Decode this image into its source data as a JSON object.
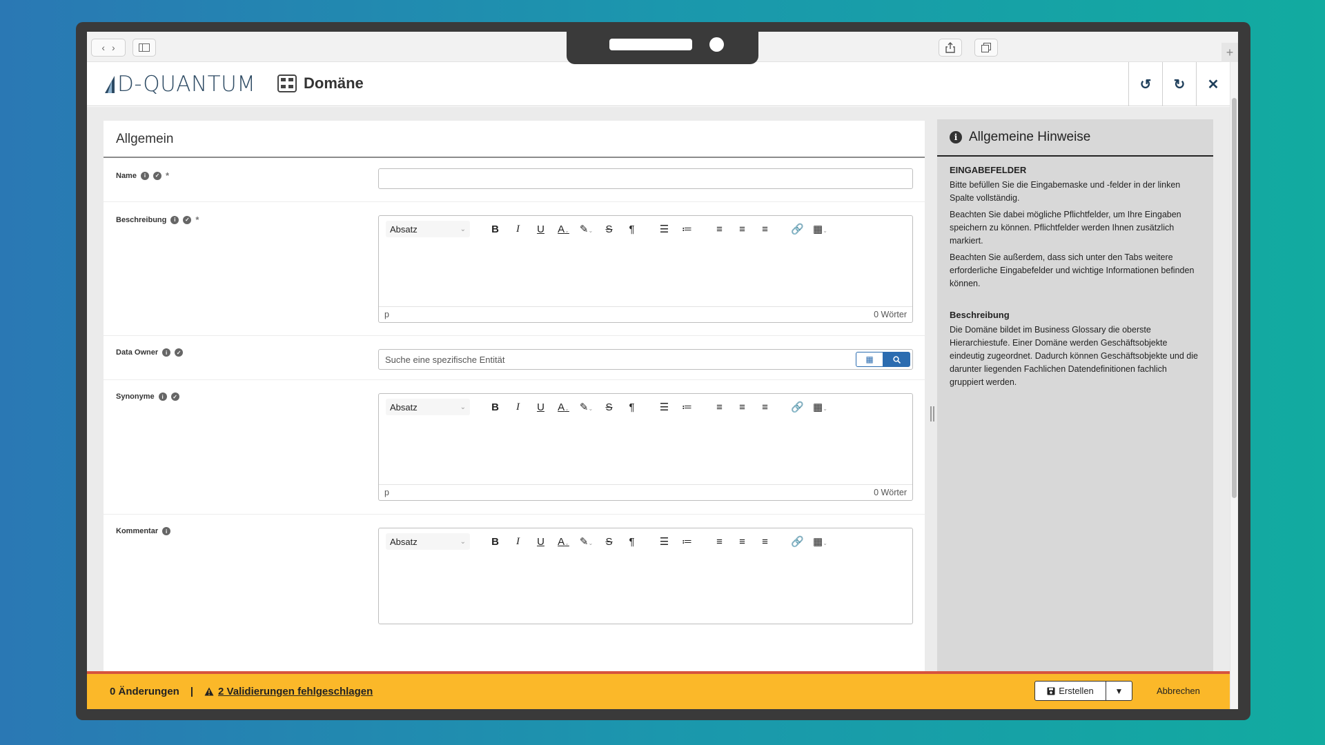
{
  "app": {
    "logo_text": "D-QUANTUM",
    "page_title": "Domäne"
  },
  "header_actions": [
    {
      "name": "undo",
      "glyph": "↺"
    },
    {
      "name": "redo",
      "glyph": "↻"
    },
    {
      "name": "close",
      "glyph": "✕"
    }
  ],
  "form": {
    "section_title": "Allgemein",
    "name": {
      "label": "Name",
      "value": ""
    },
    "beschreibung": {
      "label": "Beschreibung",
      "format": "Absatz",
      "status_path": "p",
      "word_count": "0 Wörter"
    },
    "data_owner": {
      "label": "Data Owner",
      "placeholder": "Suche eine spezifische Entität"
    },
    "synonyme": {
      "label": "Synonyme",
      "format": "Absatz",
      "status_path": "p",
      "word_count": "0 Wörter"
    },
    "kommentar": {
      "label": "Kommentar",
      "format": "Absatz"
    }
  },
  "info": {
    "title": "Allgemeine Hinweise",
    "heading1": "EINGABEFELDER",
    "p1": "Bitte befüllen Sie die Eingabemaske und -felder in der linken Spalte vollständig.",
    "p2": "Beachten Sie dabei mögliche Pflichtfelder, um Ihre Eingaben speichern zu können. Pflichtfelder werden Ihnen zusätzlich markiert.",
    "p3": "Beachten Sie außerdem, dass sich unter den Tabs weitere erforderliche Eingabefelder und wichtige Informationen befinden können.",
    "heading2": "Beschreibung",
    "p4": "Die Domäne bildet im Business Glossary die oberste Hierarchiestufe. Einer Domäne werden Geschäftsobjekte eindeutig zugeordnet. Dadurch können Geschäftsobjekte und die darunter liegenden Fachlichen Datendefinitionen fachlich gruppiert werden."
  },
  "footer": {
    "changes": "0 Änderungen",
    "separator": "|",
    "validation": "2 Validierungen fehlgeschlagen",
    "create_label": "Erstellen",
    "cancel_label": "Abbrechen"
  },
  "colors": {
    "footer_bg": "#fbb829",
    "footer_border": "#d6533e",
    "primary_blue": "#2b6cb0",
    "brand": "#2d4a63"
  }
}
